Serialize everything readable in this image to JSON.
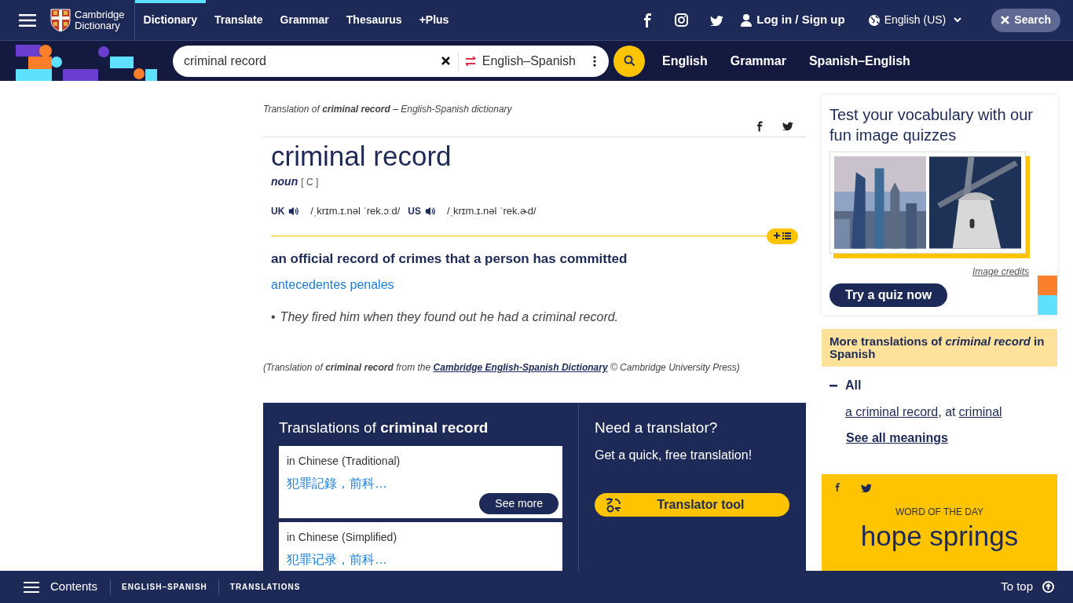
{
  "top_nav": {
    "brand": [
      "Cambridge",
      "Dictionary"
    ],
    "items": [
      {
        "label": "Dictionary",
        "selected": true
      },
      {
        "label": "Translate",
        "selected": false
      },
      {
        "label": "Grammar",
        "selected": false
      },
      {
        "label": "Thesaurus",
        "selected": false
      },
      {
        "label": "+Plus",
        "selected": false
      }
    ],
    "login": "Log in / Sign up",
    "language": "English (US)",
    "search_toggle": "Search"
  },
  "search_bar": {
    "value": "criminal record",
    "dictionary": "English–Spanish",
    "links": [
      "English",
      "Grammar",
      "Spanish–English"
    ]
  },
  "entry": {
    "source": "Translation of **criminal record** – English-Spanish dictionary",
    "headword": "criminal record",
    "pos": "noun",
    "grammar": "[ C ]",
    "pronunciations": [
      {
        "region": "UK",
        "ipa": "/ˌkrɪm.ɪ.nəl ˈrek.ɔːd/"
      },
      {
        "region": "US",
        "ipa": "/ˌkrɪm.ɪ.nəl ˈrek.ɚd/"
      }
    ],
    "definition": "an official record of crimes that a person has committed",
    "translation": "antecedentes penales",
    "examples": [
      {
        "bullet": "•",
        "text": "They fired him when they found out he had a criminal record."
      }
    ],
    "credit": {
      "before": "(Translation of **criminal record** from the",
      "link": "Cambridge English-Spanish Dictionary",
      "after": "© Cambridge University Press)"
    }
  },
  "translations": {
    "title": "Translations of **criminal record**",
    "cards": [
      {
        "language": "in Chinese (Traditional)",
        "text": "犯罪記錄，前科…",
        "button": "See more"
      },
      {
        "language": "in Chinese (Simplified)",
        "text": "犯罪记录，前科…"
      }
    ],
    "translator": {
      "title": "Need a translator?",
      "text": "Get a quick, free translation!",
      "button": "Translator tool"
    }
  },
  "quiz": {
    "title": "Test your vocabulary with our fun image quizzes",
    "credits": "Image credits",
    "button": "Try a quiz now"
  },
  "more_translations": {
    "title": "More translations of *criminal record* in Spanish",
    "group": {
      "label": "All",
      "expanded": true,
      "parts": [
        {
          "kind": "link",
          "text": "a criminal record"
        },
        {
          "kind": "text",
          "text": ", at"
        },
        {
          "kind": "link",
          "text": "criminal"
        }
      ],
      "see_all": "See all meanings"
    }
  },
  "word_of_the_day": {
    "label": "WORD OF THE DAY",
    "word": "hope springs"
  },
  "footer": {
    "contents": "Contents",
    "links": [
      "ENGLISH–SPANISH",
      "TRANSLATIONS"
    ],
    "to_top": "To top"
  }
}
